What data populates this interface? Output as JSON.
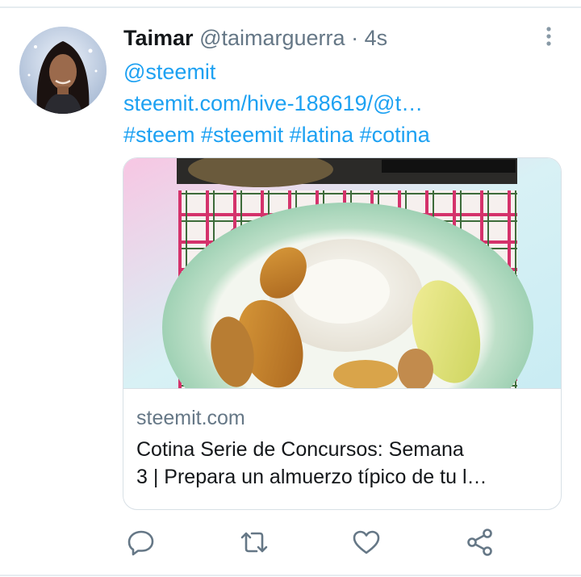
{
  "tweet": {
    "author_name": "Taimar",
    "author_handle": "@taimarguerra",
    "separator": "·",
    "time": "4s",
    "text_lines": [
      "@steemit",
      "steemit.com/hive-188619/@t…",
      "#steem #steemit #latina #cotina"
    ]
  },
  "card": {
    "domain": "steemit.com",
    "title_lines": [
      "Cotina Serie de Concursos: Semana",
      "3 | Prepara un almuerzo típico de tu l…"
    ]
  },
  "icons": {
    "more": "more-vertical-icon",
    "reply": "reply-icon",
    "retweet": "retweet-icon",
    "like": "heart-icon",
    "share": "share-icon"
  },
  "colors": {
    "link": "#1da1f2",
    "secondary_text": "#657786",
    "icon": "#657786",
    "divider": "#e6ecf0"
  }
}
